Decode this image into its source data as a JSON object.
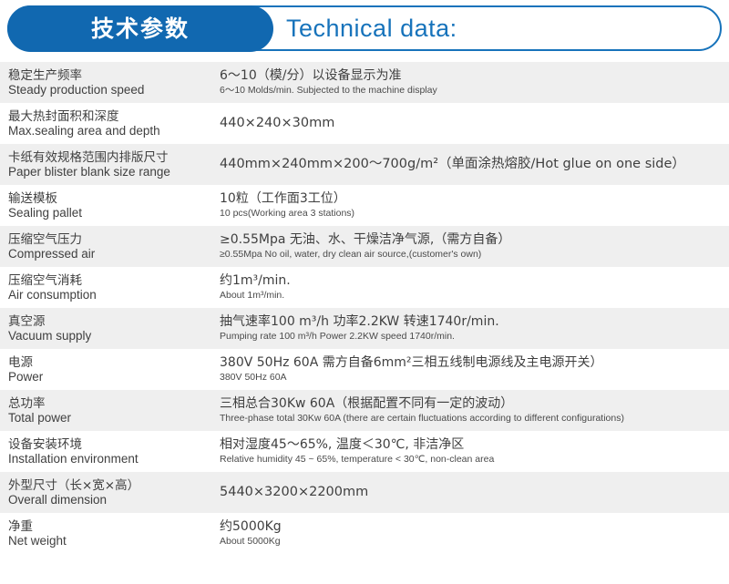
{
  "header": {
    "pill_label": "技术参数",
    "english_title": "Technical data:",
    "pill_color": "#1168b0",
    "outline_color": "#1773bb",
    "title_color": "#1773bb"
  },
  "table": {
    "row_alt_background": "#efefef",
    "row_plain_background": "#ffffff",
    "text_color": "#3f3f3f",
    "rows": [
      {
        "label_zh": "稳定生产频率",
        "label_en": "Steady production speed",
        "value_zh": "6～10（模/分）以设备显示为准",
        "value_en": "6～10 Molds/min. Subjected to the machine display",
        "single_line": false
      },
      {
        "label_zh": "最大热封面积和深度",
        "label_en": "Max.sealing area and depth",
        "value_zh": "440×240×30mm",
        "value_en": "",
        "single_line": true
      },
      {
        "label_zh": "卡纸有效规格范围内排版尺寸",
        "label_en": "Paper blister blank size range",
        "value_zh": "440mm×240mm×200～700g/m²（单面涂热熔胶/Hot glue on one side）",
        "value_en": "",
        "single_line": true
      },
      {
        "label_zh": "输送模板",
        "label_en": "Sealing pallet",
        "value_zh": "10粒（工作面3工位）",
        "value_en": "10 pcs(Working area 3 stations)",
        "single_line": false
      },
      {
        "label_zh": "压缩空气压力",
        "label_en": "Compressed air",
        "value_zh": "≥0.55Mpa   无油、水、干燥洁净气源,（需方自备）",
        "value_en": "≥0.55Mpa   No oil, water, dry clean air source,(customer's own)",
        "single_line": false
      },
      {
        "label_zh": "压缩空气消耗",
        "label_en": "Air consumption",
        "value_zh": "约1m³/min.",
        "value_en": "About 1m³/min.",
        "single_line": false
      },
      {
        "label_zh": "真空源",
        "label_en": "Vacuum supply",
        "value_zh": "抽气速率100 m³/h  功率2.2KW  转速1740r/min.",
        "value_en": "Pumping rate 100 m³/h Power 2.2KW speed 1740r/min.",
        "single_line": false
      },
      {
        "label_zh": "电源",
        "label_en": "Power",
        "value_zh": "380V 50Hz 60A 需方自备6mm²三相五线制电源线及主电源开关）",
        "value_en": "380V 50Hz 60A",
        "single_line": false
      },
      {
        "label_zh": "总功率",
        "label_en": "Total power",
        "value_zh": "三相总合30Kw 60A（根据配置不同有一定的波动）",
        "value_en": "Three-phase total 30Kw 60A (there are certain fluctuations according to different configurations)",
        "single_line": false
      },
      {
        "label_zh": "设备安装环境",
        "label_en": "Installation environment",
        "value_zh": "相对湿度45～65%,  温度＜30℃, 非洁净区",
        "value_en": "Relative humidity 45 ~ 65%, temperature < 30℃, non-clean area",
        "single_line": false
      },
      {
        "label_zh": "外型尺寸（长×宽×高）",
        "label_en": "Overall dimension",
        "value_zh": "5440×3200×2200mm",
        "value_en": "",
        "single_line": true
      },
      {
        "label_zh": "净重",
        "label_en": "Net weight",
        "value_zh": "约5000Kg",
        "value_en": "About 5000Kg",
        "single_line": false
      }
    ]
  }
}
